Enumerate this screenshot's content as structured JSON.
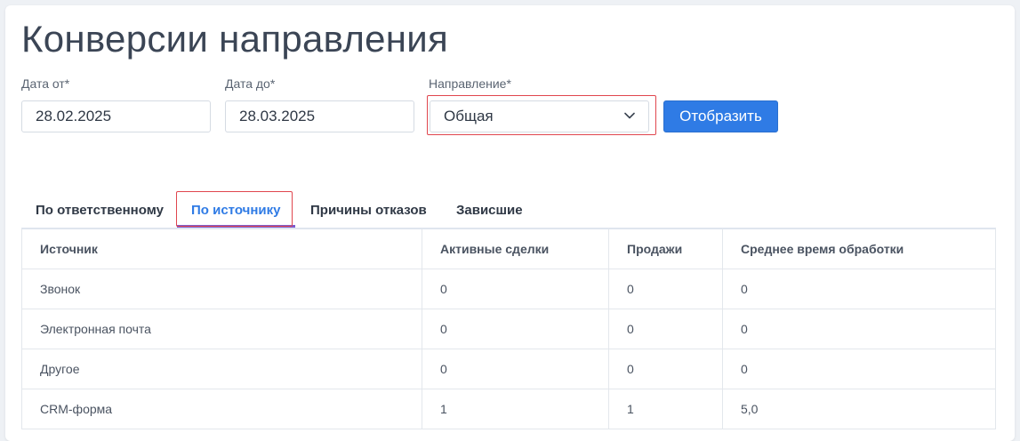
{
  "page": {
    "title": "Конверсии направления"
  },
  "filters": {
    "date_from": {
      "label": "Дата от*",
      "value": "28.02.2025"
    },
    "date_to": {
      "label": "Дата до*",
      "value": "28.03.2025"
    },
    "direction": {
      "label": "Направление*",
      "value": "Общая"
    },
    "show_label": "Отобразить"
  },
  "tabs": [
    {
      "label": "По ответственному",
      "active": false
    },
    {
      "label": "По источнику",
      "active": true
    },
    {
      "label": "Причины отказов",
      "active": false
    },
    {
      "label": "Зависшие",
      "active": false
    }
  ],
  "table": {
    "columns": [
      "Источник",
      "Активные сделки",
      "Продажи",
      "Среднее время обработки"
    ],
    "rows": [
      [
        "Звонок",
        "0",
        "0",
        "0"
      ],
      [
        "Электронная почта",
        "0",
        "0",
        "0"
      ],
      [
        "Другое",
        "0",
        "0",
        "0"
      ],
      [
        "CRM-форма",
        "1",
        "1",
        "5,0"
      ]
    ]
  },
  "colors": {
    "accent": "#2f7be5",
    "highlight": "#e0464e",
    "tab_underline": "#7b5ccf"
  },
  "icons": {
    "direction_select": "chevron-down-icon"
  }
}
